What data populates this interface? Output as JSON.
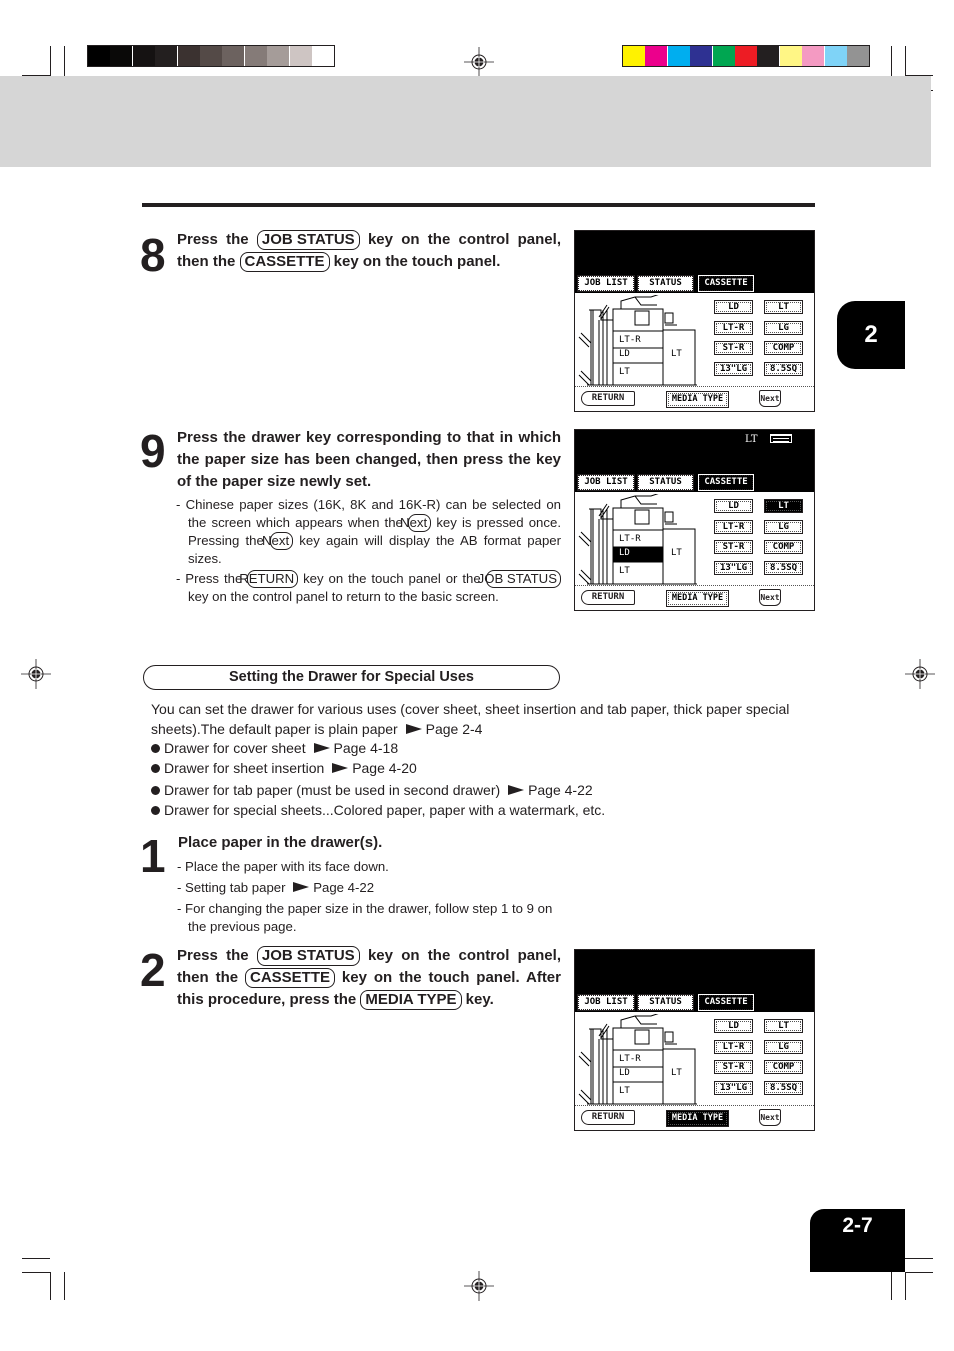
{
  "print_marks": {
    "grayscale_swatches": [
      "#000000",
      "#0a0908",
      "#151212",
      "#231f1f",
      "#3b3230",
      "#544a47",
      "#6c625f",
      "#857b78",
      "#a59c99",
      "#cec5c3",
      "#ffffff"
    ],
    "color_swatches": [
      "#fff200",
      "#ec008c",
      "#00aeef",
      "#2e3192",
      "#00a651",
      "#ed1c24",
      "#231f20",
      "#fff685",
      "#f49ac2",
      "#7fd3f7",
      "#939393"
    ]
  },
  "chapter_tab": {
    "label": "2"
  },
  "page_number": {
    "label": "2-7"
  },
  "steps_top": [
    {
      "number": "8",
      "title_parts": [
        "Press the ",
        "JOB STATUS",
        " key on the control panel, then the ",
        "CASSETTE",
        " key on the touch panel."
      ]
    },
    {
      "number": "9",
      "title": "Press the drawer key corresponding to that in which the paper size has been changed, then press the key of the paper size newly set.",
      "notes": [
        {
          "parts": [
            "- Chinese paper sizes (16K, 8K and 16K-R) can be selected on the screen which appears when the ",
            "Next",
            " key is pressed once. Pressing the ",
            "Next",
            " key again will display the AB format paper sizes."
          ]
        },
        {
          "parts": [
            "- Press the ",
            "RETURN",
            " key on the touch panel or the ",
            "JOB STATUS",
            " key on the control panel  to return to the basic screen."
          ]
        }
      ]
    }
  ],
  "panel": {
    "tabs": [
      "JOB LIST",
      "STATUS",
      "CASSETTE"
    ],
    "size_buttons": [
      "LD",
      "LT",
      "LT-R",
      "LG",
      "ST-R",
      "COMP",
      "13\"LG",
      "8.5SQ"
    ],
    "drawers": [
      "LT-R",
      "LD",
      "LT"
    ],
    "lcf_label": "LT",
    "return_label": "RETURN",
    "media_type_label": "MEDIA TYPE",
    "next_label": "Next",
    "status_size": "LT"
  },
  "section": {
    "title": "Setting the Drawer for Special Uses",
    "intro": "You can set the drawer for various uses (cover sheet, sheet insertion and tab paper, thick paper special sheets).The default paper is plain paper",
    "intro_ref": "Page 2-4",
    "bullets": [
      {
        "text": "Drawer for cover sheet",
        "ref": "Page 4-18"
      },
      {
        "text": "Drawer for sheet insertion",
        "ref": "Page 4-20"
      },
      {
        "text": "Drawer for tab paper (must be used in second drawer)",
        "ref": "Page 4-22"
      },
      {
        "text": "Drawer for special sheets...Colored paper, paper with a watermark, etc.",
        "ref": ""
      }
    ]
  },
  "steps_bottom": [
    {
      "number": "1",
      "title": "Place paper in the drawer(s).",
      "notes": [
        "- Place the paper with its face down.",
        "-  Setting tab paper",
        "-  For changing the paper size in the drawer, follow step 1 to 9 on the previous page."
      ],
      "note_ref": "Page 4-22"
    },
    {
      "number": "2",
      "title_parts": [
        "Press the ",
        "JOB STATUS",
        " key on the control panel, then the ",
        "CASSETTE",
        " key on the touch panel.  After this procedure,  press the ",
        "MEDIA TYPE",
        " key."
      ]
    }
  ]
}
